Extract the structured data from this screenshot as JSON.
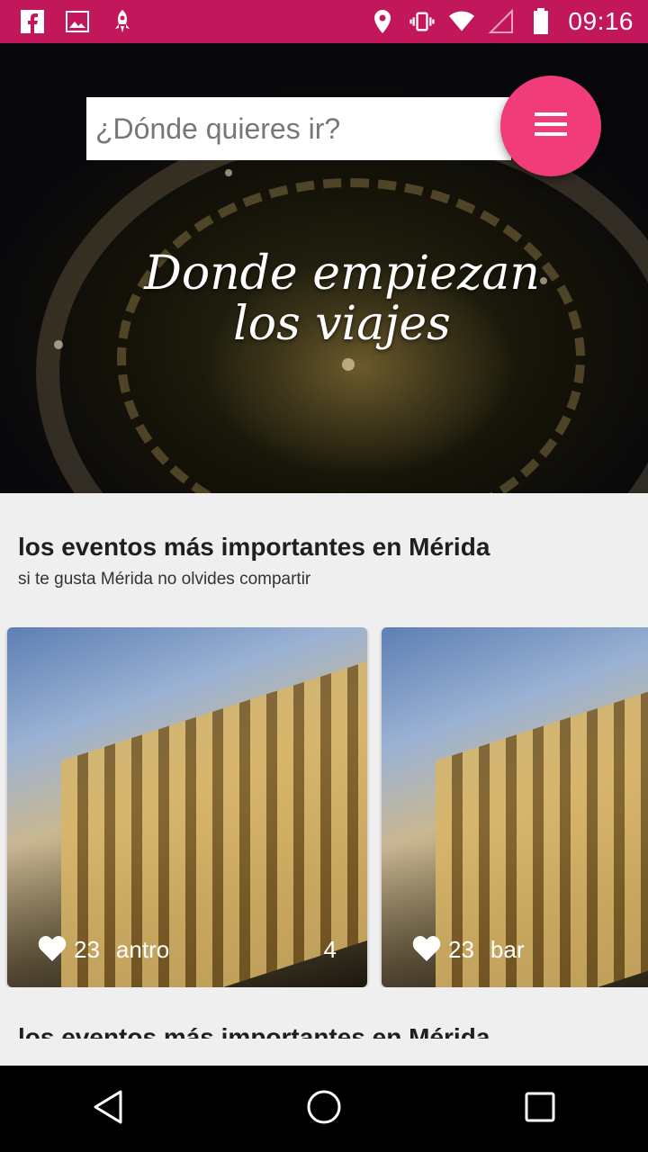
{
  "status_bar": {
    "time": "09:16",
    "left_icons": [
      "facebook-icon",
      "image-icon",
      "rocket-icon"
    ],
    "right_icons": [
      "location-icon",
      "vibrate-icon",
      "wifi-icon",
      "signal-icon",
      "battery-icon"
    ]
  },
  "hero": {
    "search_placeholder": "¿Dónde quieres ir?",
    "tagline_line1": "Donde empiezan",
    "tagline_line2": "los viajes",
    "menu_icon": "hamburger-menu-icon",
    "accent_color": "#f03c78"
  },
  "section": {
    "title": "los eventos más importantes en Mérida",
    "subtitle": "si te gusta Mérida no olvides compartir"
  },
  "cards": [
    {
      "likes": "23",
      "category": "antro",
      "extra": "4"
    },
    {
      "likes": "23",
      "category": "bar",
      "extra": ""
    }
  ],
  "section2": {
    "title": "los eventos más importantes en Mérida"
  },
  "nav": [
    "back-icon",
    "home-icon",
    "recents-icon"
  ],
  "colors": {
    "status_bar": "#c2185b",
    "background": "#efefef"
  }
}
